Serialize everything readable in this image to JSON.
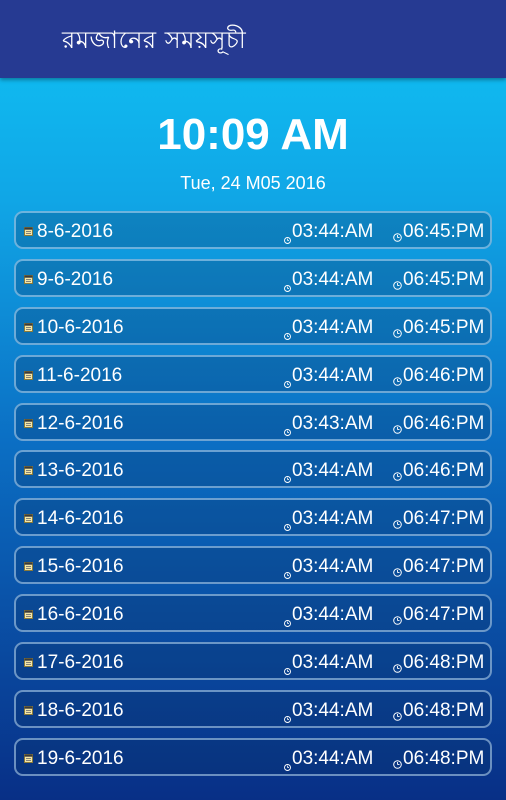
{
  "appbar": {
    "title": "রমজানের সময়সূচী"
  },
  "clock": {
    "time": "10:09 AM",
    "date": "Tue, 24 M05 2016"
  },
  "schedule": [
    {
      "date": "8-6-2016",
      "sehri": "03:44:AM",
      "iftar": "06:45:PM"
    },
    {
      "date": "9-6-2016",
      "sehri": "03:44:AM",
      "iftar": "06:45:PM"
    },
    {
      "date": "10-6-2016",
      "sehri": "03:44:AM",
      "iftar": "06:45:PM"
    },
    {
      "date": "11-6-2016",
      "sehri": "03:44:AM",
      "iftar": "06:46:PM"
    },
    {
      "date": "12-6-2016",
      "sehri": "03:43:AM",
      "iftar": "06:46:PM"
    },
    {
      "date": "13-6-2016",
      "sehri": "03:44:AM",
      "iftar": "06:46:PM"
    },
    {
      "date": "14-6-2016",
      "sehri": "03:44:AM",
      "iftar": "06:47:PM"
    },
    {
      "date": "15-6-2016",
      "sehri": "03:44:AM",
      "iftar": "06:47:PM"
    },
    {
      "date": "16-6-2016",
      "sehri": "03:44:AM",
      "iftar": "06:47:PM"
    },
    {
      "date": "17-6-2016",
      "sehri": "03:44:AM",
      "iftar": "06:48:PM"
    },
    {
      "date": "18-6-2016",
      "sehri": "03:44:AM",
      "iftar": "06:48:PM"
    },
    {
      "date": "19-6-2016",
      "sehri": "03:44:AM",
      "iftar": "06:48:PM"
    }
  ],
  "icons": {
    "row_date": "calendar-icon",
    "row_sehri": "clock-icon",
    "row_iftar": "clock-icon"
  },
  "colors": {
    "appbar": "#263a92",
    "background_top": "#0fc4f5",
    "background_bottom": "#082f86",
    "text": "#ffffff"
  }
}
